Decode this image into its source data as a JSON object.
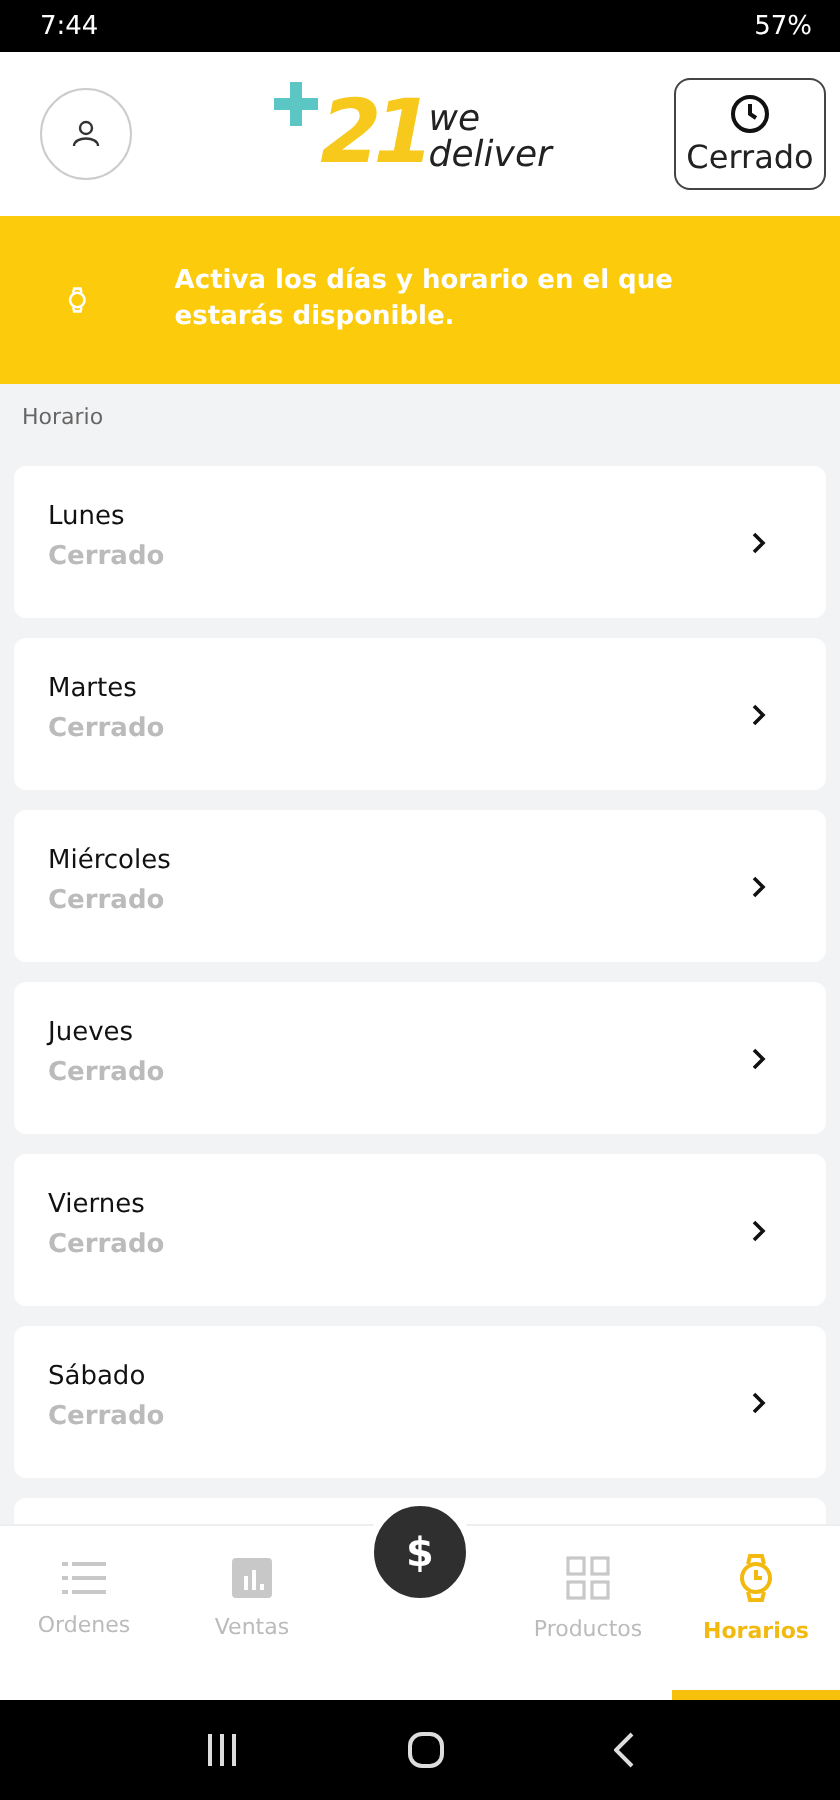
{
  "status_bar": {
    "time": "7:44",
    "battery": "57%"
  },
  "header": {
    "status_button": "Cerrado"
  },
  "logo": {
    "number": "21",
    "line_1": "we",
    "line_2": "deliver"
  },
  "banner": {
    "message": "Activa los días y horario en el que estarás disponible."
  },
  "section_label": "Horario",
  "days": [
    {
      "name": "Lunes",
      "status": "Cerrado"
    },
    {
      "name": "Martes",
      "status": "Cerrado"
    },
    {
      "name": "Miércoles",
      "status": "Cerrado"
    },
    {
      "name": "Jueves",
      "status": "Cerrado"
    },
    {
      "name": "Viernes",
      "status": "Cerrado"
    },
    {
      "name": "Sábado",
      "status": "Cerrado"
    }
  ],
  "fab": {
    "symbol": "$"
  },
  "nav": [
    {
      "label": "Ordenes",
      "kind": "list",
      "selected": false
    },
    {
      "label": "Ventas",
      "kind": "chart",
      "selected": false
    },
    {
      "label": "Productos",
      "kind": "grid",
      "selected": false
    },
    {
      "label": "Horarios",
      "kind": "watch",
      "selected": true
    }
  ]
}
